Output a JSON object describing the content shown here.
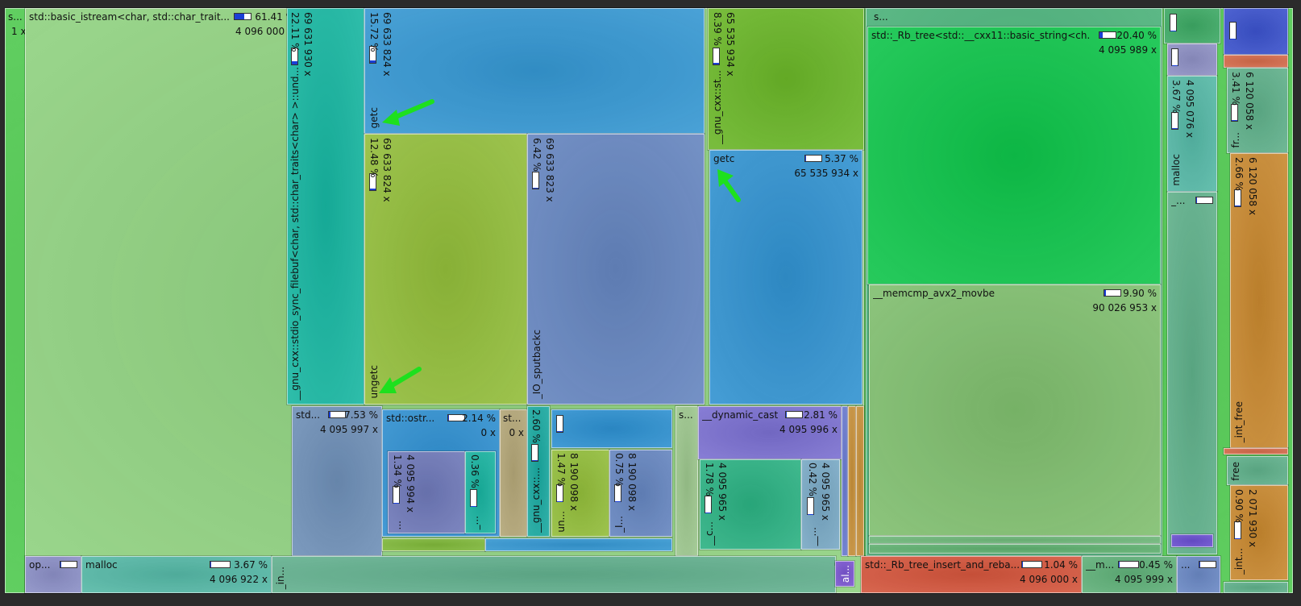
{
  "colors": {
    "accent_arrow": "#1ee01e",
    "bar_fill": "#1a3fd6"
  },
  "labels": {
    "root_name": "s...",
    "root_count": "1 x",
    "istream_name": "std::basic_istream<char, std::char_trait...",
    "istream_pct": "61.41 %",
    "istream_count": "4 096 000 x",
    "filebuf_pct": "22.11 %",
    "filebuf_count": "69 631 930 x",
    "filebuf_name": "__gnu_cxx::stdio_sync_filebuf<char, std::char_traits<char> >::und...",
    "getc1_pct": "15.72 %",
    "getc1_count": "69 633 824 x",
    "getc1_name": "getc",
    "ungetc_pct": "12.48 %",
    "ungetc_count": "69 633 824 x",
    "ungetc_name": "ungetc",
    "sputback_pct": "6.42 %",
    "sputback_count": "69 633 823 x",
    "sputback_name": "_IO_sputbackc",
    "gnu2_pct": "8.39 %",
    "gnu2_count": "65 535 934 x",
    "gnu2_name": "__gnu_cxx::st...",
    "getc2_name": "getc",
    "getc2_pct": "5.37 %",
    "getc2_count": "65 535 934 x",
    "std1_name": "std...",
    "std1_pct": "7.53 %",
    "std1_count": "4 095 997 x",
    "ostr_name": "std::ostr...",
    "ostr_pct": "2.14 %",
    "ostr_count": "0 x",
    "st_name": "st...",
    "st_count": "0 x",
    "s134_pct": "1.34 %",
    "s134_count": "4 095 994 x",
    "s134_name": "...",
    "s036_pct": "0.36 %",
    "s036_name": "_...",
    "gnu3_pct": "2.60 %",
    "gnu3_name": "__gnu_cxx::...",
    "un_pct": "1.47 %",
    "un_count": "8 190 098 x",
    "un_name": "un...",
    "io_pct": "0.75 %",
    "io_count": "8 190 098 x",
    "io_name": "_I...",
    "s_mid_name": "s...",
    "dyn_name": "__dynamic_cast",
    "dyn_pct": "2.81 %",
    "dyn_count": "4 095 996 x",
    "c_pct": "1.78 %",
    "c_count": "4 095 965 x",
    "c_name": "__c...",
    "s042_pct": "0.42 %",
    "s042_count": "4 095 965 x",
    "s042_name": "__...",
    "s_right_name": "s...",
    "rb_name": "std::_Rb_tree<std::__cxx11::basic_string<ch...",
    "rb_pct": "20.40 %",
    "rb_count": "4 095 989 x",
    "memcmp_name": "__memcmp_avx2_movbe",
    "memcmp_pct": "9.90 %",
    "memcmp_count": "90 026 953 x",
    "malloc2_pct": "3.67 %",
    "malloc2_count": "4 095 076 x",
    "malloc2_name": "malloc",
    "us_name": "_...",
    "fr_pct": "3.41 %",
    "fr_count": "6 120 058 x",
    "fr_name": "fr...",
    "intfree_pct": "2.66 %",
    "intfree_count": "6 120 058 x",
    "intfree_name": "_int_free",
    "free_name": "free",
    "int090_pct": "0.90 %",
    "int090_count": "2 071 930 x",
    "int090_name": "_int...",
    "op_name": "op...",
    "malloc_name": "malloc",
    "malloc_pct": "3.67 %",
    "malloc_count": "4 096 922 x",
    "in_name": "_in...",
    "al_name": "al...",
    "rbins_name": "std::_Rb_tree_insert_and_reba...",
    "rbins_pct": "1.04 %",
    "rbins_count": "4 096 000 x",
    "m_name": "__m...",
    "m_pct": "0.45 %",
    "m_count": "4 095 999 x",
    "dots_name": "..."
  }
}
